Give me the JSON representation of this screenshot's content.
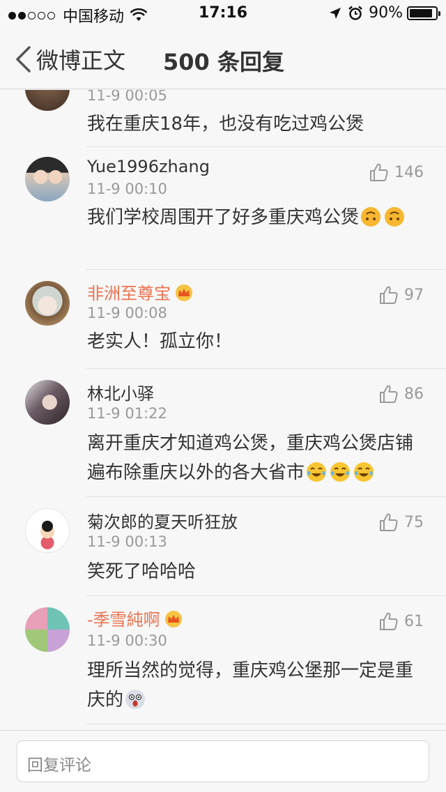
{
  "status": {
    "carrier": "中国移动",
    "time": "17:16",
    "battery": "90%",
    "battery_level": 0.9,
    "signal_bars": 2
  },
  "nav": {
    "back_label": "微博正文",
    "title": "500 条回复"
  },
  "comments": [
    {
      "name": "",
      "time": "11-9 00:05",
      "text": "我在重庆18年，也没有吃过鸡公煲",
      "likes": "",
      "vip": false
    },
    {
      "name": "Yue1996zhang",
      "time": "11-9 00:10",
      "text": "我们学校周围开了好多重庆鸡公煲",
      "likes": "146",
      "vip": false
    },
    {
      "name": "非洲至尊宝",
      "time": "11-9 00:08",
      "text": "老实人！孤立你！",
      "likes": "97",
      "vip": true
    },
    {
      "name": "林北小驿",
      "time": "11-9 01:22",
      "text": "离开重庆才知道鸡公煲，重庆鸡公煲店铺遍布除重庆以外的各大省市",
      "likes": "86",
      "vip": false
    },
    {
      "name": "菊次郎的夏天听狂放",
      "time": "11-9 00:13",
      "text": "笑死了哈哈哈",
      "likes": "75",
      "vip": false
    },
    {
      "name": "-季雪純啊",
      "time": "11-9 00:30",
      "text": "理所当然的觉得，重庆鸡公堡那一定是重庆的",
      "likes": "61",
      "vip": true
    }
  ],
  "reply": {
    "placeholder": "回复评论"
  },
  "colors": {
    "vip_name": "#eb7350",
    "meta": "#999999",
    "background": "#f7f7f7"
  }
}
